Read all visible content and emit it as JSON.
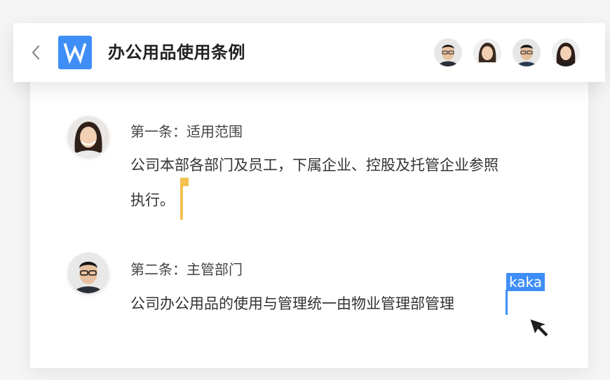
{
  "header": {
    "title": "办公用品使用条例",
    "back_icon": "chevron-left-icon",
    "app_icon": "wps-writer-icon",
    "app_icon_color": "#3f8ef7",
    "collaborators": [
      {
        "name": "collaborator-1"
      },
      {
        "name": "collaborator-2"
      },
      {
        "name": "collaborator-3"
      },
      {
        "name": "collaborator-4"
      }
    ]
  },
  "document": {
    "sections": [
      {
        "heading": "第一条：适用范围",
        "body_line1": "公司本部各部门及员工，下属企业、控股及托管企业参照",
        "body_line2": "执行。"
      },
      {
        "heading": "第二条：主管部门",
        "body_line1": "公司办公用品的使用与管理统一由物业管理部管理"
      }
    ]
  },
  "cursors": {
    "remote_user_label": "kaka",
    "blue": "#3f8ef7",
    "yellow": "#f2c14e"
  }
}
